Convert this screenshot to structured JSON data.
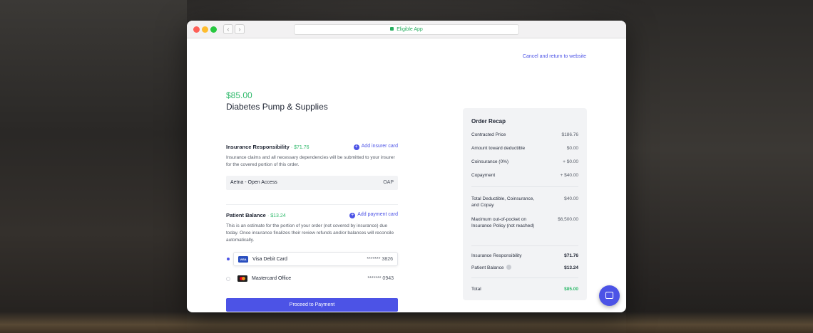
{
  "browser": {
    "url_label": "Eligible App",
    "back_glyph": "‹",
    "forward_glyph": "›"
  },
  "header": {
    "cancel_link": "Cancel and return to website"
  },
  "order": {
    "price": "$85.00",
    "product": "Diabetes Pump & Supplies"
  },
  "insurance": {
    "title": "Insurance Responsibility",
    "amount": "· $71.76",
    "action": "Add insurer card",
    "description": "Insurance claims and all necessary dependencies will be submitted to your insurer for the covered portion of this order.",
    "plan_name": "Aetna - Open Access",
    "plan_code": "OAP"
  },
  "patient": {
    "title": "Patient Balance",
    "amount": "· $13.24",
    "action": "Add payment card",
    "description": "This is an estimate for the portion of your order (not covered by insurance) due today. Once insurance finalizes their review refunds and/or balances will reconcile automatically.",
    "cards": [
      {
        "name": "Visa Debit Card",
        "number": "******* 3826",
        "brand": "VISA",
        "selected": true
      },
      {
        "name": "Mastercard Office",
        "number": "******* 0943",
        "brand": "mastercard",
        "selected": false
      }
    ]
  },
  "proceed_button": "Proceed to Payment",
  "recap": {
    "title": "Order Recap",
    "rows": [
      {
        "label": "Contracted Price",
        "value": "$186.76"
      },
      {
        "label": "Amount toward deductible",
        "value": "$0.00"
      },
      {
        "label": "Coinsurance (0%)",
        "value": "+ $0.00"
      },
      {
        "label": "Copayment",
        "value": "+ $40.00"
      }
    ],
    "rows2": [
      {
        "label": "Total Deductible, Coinsurance, and Copay",
        "value": "$40.00"
      },
      {
        "label": "Maximum out-of-pocket on Insurance Policy (not reached)",
        "value": "$6,500.00"
      }
    ],
    "rows3": [
      {
        "label": "Insurance Responsibility",
        "value": "$71.76"
      },
      {
        "label": "Patient Balance",
        "value": "$13.24"
      }
    ],
    "total_label": "Total",
    "total_value": "$85.00"
  },
  "colors": {
    "accent": "#4c53e6",
    "success": "#2fb96b"
  },
  "icons": [
    "lock-icon",
    "plus-circle-icon",
    "visa-icon",
    "mastercard-icon",
    "info-icon",
    "chat-icon"
  ]
}
